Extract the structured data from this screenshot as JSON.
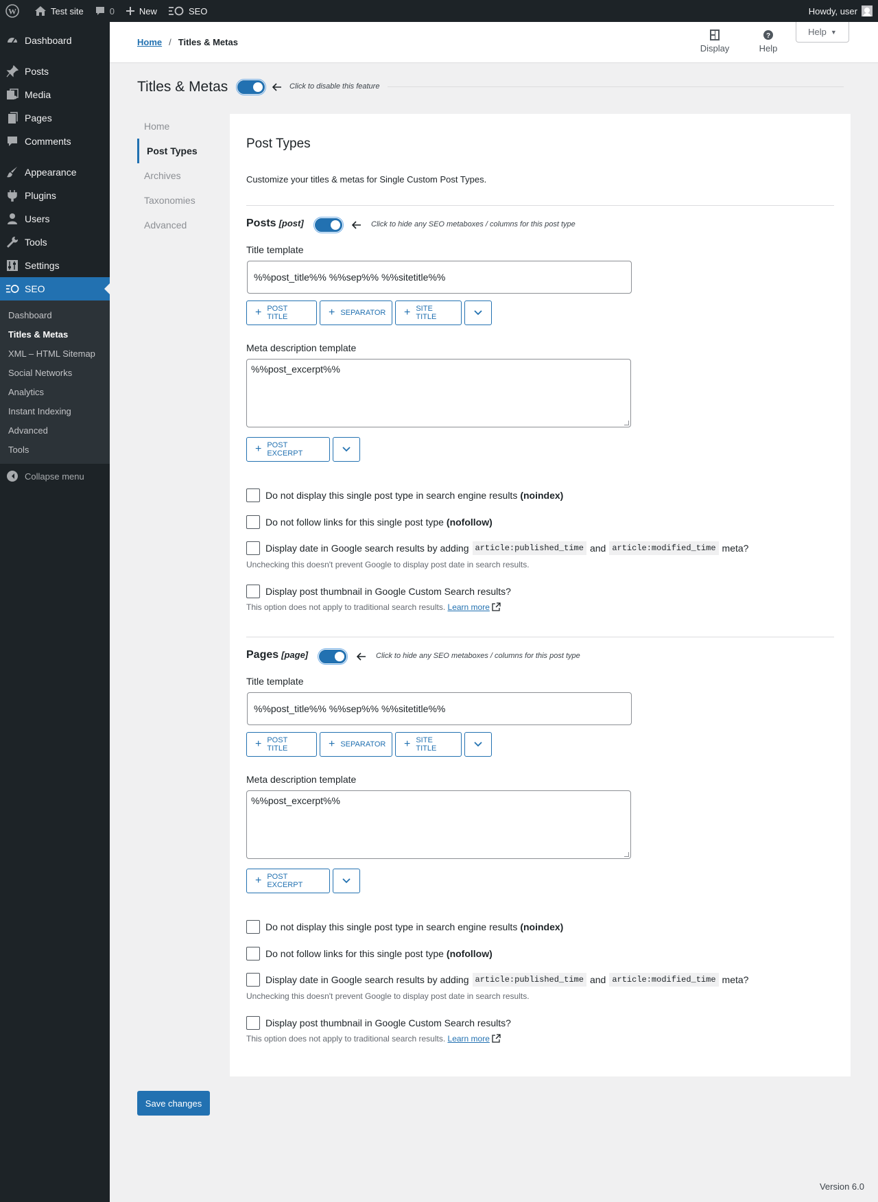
{
  "adminbar": {
    "site_name": "Test site",
    "comments_count": "0",
    "new_label": "New",
    "seo_label": "SEO",
    "howdy": "Howdy, user"
  },
  "sidebar": {
    "items": [
      {
        "label": "Dashboard",
        "icon": "dashboard-icon"
      },
      {
        "label": "Posts",
        "icon": "pin-icon"
      },
      {
        "label": "Media",
        "icon": "media-icon"
      },
      {
        "label": "Pages",
        "icon": "pages-icon"
      },
      {
        "label": "Comments",
        "icon": "comment-icon"
      },
      {
        "label": "Appearance",
        "icon": "brush-icon"
      },
      {
        "label": "Plugins",
        "icon": "plug-icon"
      },
      {
        "label": "Users",
        "icon": "user-icon"
      },
      {
        "label": "Tools",
        "icon": "wrench-icon"
      },
      {
        "label": "Settings",
        "icon": "settings-icon"
      },
      {
        "label": "SEO",
        "icon": "seo-icon"
      }
    ],
    "submenu": [
      "Dashboard",
      "Titles & Metas",
      "XML – HTML Sitemap",
      "Social Networks",
      "Analytics",
      "Instant Indexing",
      "Advanced",
      "Tools"
    ],
    "collapse": "Collapse menu"
  },
  "header": {
    "breadcrumb_home": "Home",
    "breadcrumb_sep": "/",
    "breadcrumb_current": "Titles & Metas",
    "display_label": "Display",
    "help_label": "Help",
    "help_tab": "Help"
  },
  "page": {
    "title": "Titles & Metas",
    "feature_hint": "Click to disable this feature",
    "tabs": [
      "Home",
      "Post Types",
      "Archives",
      "Taxonomies",
      "Advanced"
    ],
    "active_tab": "Post Types"
  },
  "panel": {
    "heading": "Post Types",
    "intro": "Customize your titles & metas for Single Custom Post Types.",
    "post_types": [
      {
        "name": "Posts",
        "slug": "[post]",
        "hint": "Click to hide any SEO metaboxes / columns for this post type",
        "title_label": "Title template",
        "title_value": "%%post_title%% %%sep%% %%sitetitle%%",
        "buttons": [
          "POST TITLE",
          "SEPARATOR",
          "SITE TITLE"
        ],
        "meta_label": "Meta description template",
        "meta_value": "%%post_excerpt%%",
        "meta_button": "POST EXCERPT",
        "noindex_text": "Do not display this single post type in search engine results",
        "noindex_bold": "(noindex)",
        "nofollow_text": "Do not follow links for this single post type",
        "nofollow_bold": "(nofollow)",
        "date_text": "Display date in Google search results by adding",
        "date_code1": "article:published_time",
        "date_and": "and",
        "date_code2": "article:modified_time",
        "date_end": "meta?",
        "date_desc": "Unchecking this doesn't prevent Google to display post date in search results.",
        "thumb_text": "Display post thumbnail in Google Custom Search results?",
        "thumb_desc": "This option does not apply to traditional search results.",
        "learn_more": "Learn more"
      },
      {
        "name": "Pages",
        "slug": "[page]",
        "hint": "Click to hide any SEO metaboxes / columns for this post type",
        "title_label": "Title template",
        "title_value": "%%post_title%% %%sep%% %%sitetitle%%",
        "buttons": [
          "POST TITLE",
          "SEPARATOR",
          "SITE TITLE"
        ],
        "meta_label": "Meta description template",
        "meta_value": "%%post_excerpt%%",
        "meta_button": "POST EXCERPT",
        "noindex_text": "Do not display this single post type in search engine results",
        "noindex_bold": "(noindex)",
        "nofollow_text": "Do not follow links for this single post type",
        "nofollow_bold": "(nofollow)",
        "date_text": "Display date in Google search results by adding",
        "date_code1": "article:published_time",
        "date_and": "and",
        "date_code2": "article:modified_time",
        "date_end": "meta?",
        "date_desc": "Unchecking this doesn't prevent Google to display post date in search results.",
        "thumb_text": "Display post thumbnail in Google Custom Search results?",
        "thumb_desc": "This option does not apply to traditional search results.",
        "learn_more": "Learn more"
      }
    ]
  },
  "footer": {
    "save_label": "Save changes",
    "version": "Version 6.0"
  },
  "colors": {
    "accent": "#2271b1",
    "sidebar_bg": "#1d2327",
    "submenu_bg": "#2c3338"
  }
}
